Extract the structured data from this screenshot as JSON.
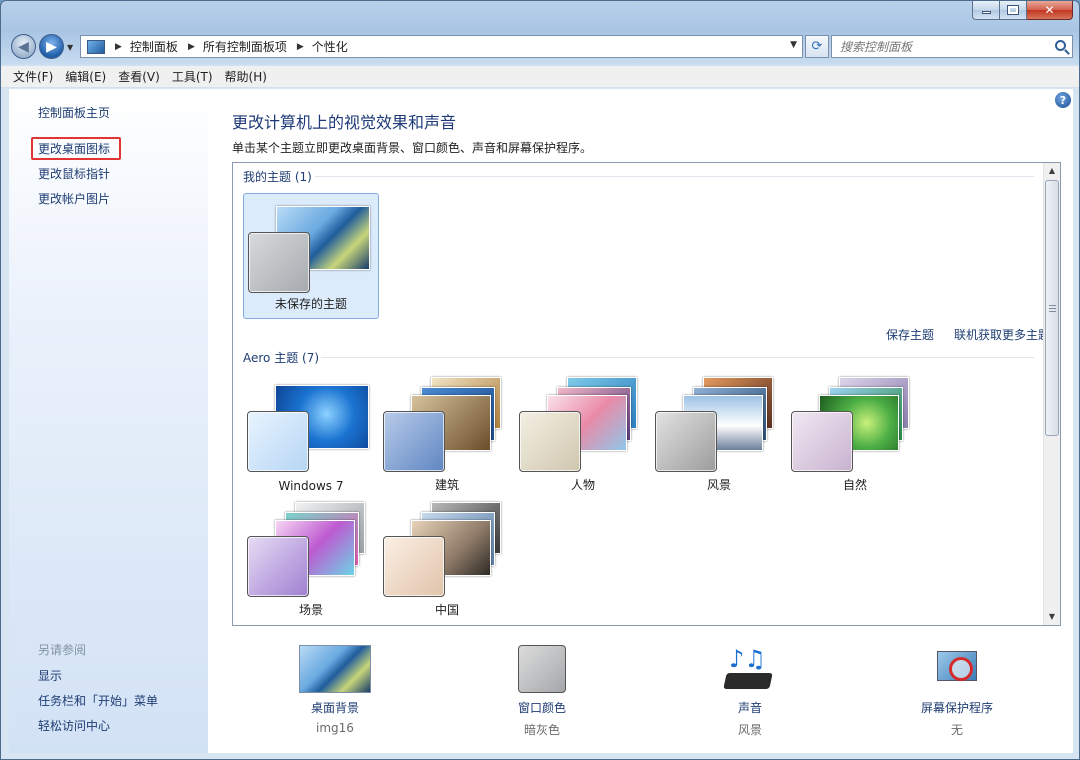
{
  "window": {
    "caption": {
      "minimize": "–",
      "maximize": "□",
      "close": "✕"
    }
  },
  "address": {
    "crumbs": [
      "控制面板",
      "所有控制面板项",
      "个性化"
    ],
    "search_placeholder": "搜索控制面板"
  },
  "menu": [
    "文件(F)",
    "编辑(E)",
    "查看(V)",
    "工具(T)",
    "帮助(H)"
  ],
  "sidebar": {
    "home": "控制面板主页",
    "links": [
      "更改桌面图标",
      "更改鼠标指针",
      "更改帐户图片"
    ],
    "see_also_title": "另请参阅",
    "see_also": [
      "显示",
      "任务栏和「开始」菜单",
      "轻松访问中心"
    ]
  },
  "main": {
    "title": "更改计算机上的视觉效果和声音",
    "subtitle": "单击某个主题立即更改桌面背景、窗口颜色、声音和屏幕保护程序。",
    "my_themes_heading": "我的主题 (1)",
    "my_themes": [
      {
        "name": "未保存的主题",
        "accent": "#9fc9ee",
        "tint": "#b8bcc0"
      }
    ],
    "links": {
      "save": "保存主题",
      "more_online": "联机获取更多主题"
    },
    "aero_heading": "Aero 主题 (7)",
    "aero_themes": [
      {
        "name": "Windows 7",
        "accent": "#1b73d1",
        "tint": "#cde4fb"
      },
      {
        "name": "建筑",
        "accent": "#3b7cc6",
        "tint": "#90aad6"
      },
      {
        "name": "人物",
        "accent": "#e98aa8",
        "tint": "#e8e0c9"
      },
      {
        "name": "风景",
        "accent": "#c0d8ef",
        "tint": "#c7c7c7"
      },
      {
        "name": "自然",
        "accent": "#4cae45",
        "tint": "#d9c9dd"
      },
      {
        "name": "场景",
        "accent": "#bd5bd0",
        "tint": "#b59bd6"
      },
      {
        "name": "中国",
        "accent": "#8c7866",
        "tint": "#f0dccb"
      }
    ]
  },
  "settings": [
    {
      "label": "桌面背景",
      "value": "img16"
    },
    {
      "label": "窗口颜色",
      "value": "暗灰色"
    },
    {
      "label": "声音",
      "value": "风景"
    },
    {
      "label": "屏幕保护程序",
      "value": "无"
    }
  ],
  "colors": {
    "link": "#1e3d72",
    "title": "#1e3a78",
    "highlight_box": "#e33434",
    "selection": "#dcebfc"
  }
}
